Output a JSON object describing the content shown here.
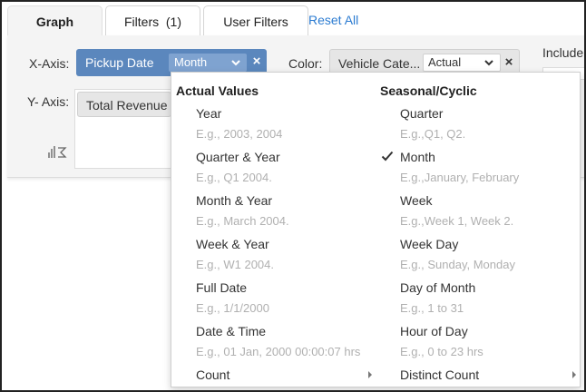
{
  "tabs": {
    "graph": "Graph",
    "filters": "Filters  (1)",
    "user_filters": "User Filters",
    "reset_all": "Reset All"
  },
  "labels": {
    "x_axis": "X-Axis:",
    "y_axis": "Y- Axis:",
    "color": "Color:",
    "include": "Include"
  },
  "x_axis_chip": {
    "field": "Pickup Date",
    "aggregation": "Month",
    "close": "×"
  },
  "color_chip": {
    "field": "Vehicle Cate...",
    "aggregation": "Actual",
    "close": "×"
  },
  "y_axis_chip": {
    "field": "Total Revenue"
  },
  "dropdown": {
    "actual_heading": "Actual Values",
    "seasonal_heading": "Seasonal/Cyclic",
    "actual_items": [
      {
        "name": "Year",
        "example": "E.g., 2003, 2004"
      },
      {
        "name": "Quarter & Year",
        "example": "E.g., Q1 2004."
      },
      {
        "name": "Month & Year",
        "example": "E.g., March 2004."
      },
      {
        "name": "Week & Year",
        "example": "E.g., W1 2004."
      },
      {
        "name": "Full Date",
        "example": "E.g., 1/1/2000"
      },
      {
        "name": "Date & Time",
        "example": "E.g., 01 Jan, 2000 00:00:07 hrs"
      },
      {
        "name": "Count",
        "example": ""
      }
    ],
    "seasonal_items": [
      {
        "name": "Quarter",
        "example": "E.g.,Q1, Q2."
      },
      {
        "name": "Month",
        "example": "E.g.,January, February"
      },
      {
        "name": "Week",
        "example": "E.g.,Week 1, Week 2."
      },
      {
        "name": "Week Day",
        "example": "E.g., Sunday, Monday"
      },
      {
        "name": "Day of Month",
        "example": "E.g., 1 to 31"
      },
      {
        "name": "Hour of Day",
        "example": "E.g., 0 to 23 hrs"
      },
      {
        "name": "Distinct Count",
        "example": ""
      }
    ],
    "selected": "Month"
  },
  "icons": {
    "chevron": "chevron-down-icon",
    "close": "close-icon",
    "check": "check-icon",
    "submenu": "caret-right-icon",
    "sort": "sort-icon"
  },
  "colors": {
    "accent_chip": "#5b87bd",
    "accent_chip_inner": "#7fa3d0",
    "link": "#2b7bd1",
    "panel_bg": "#f4f4f4",
    "muted_text": "#b0b0b0"
  }
}
